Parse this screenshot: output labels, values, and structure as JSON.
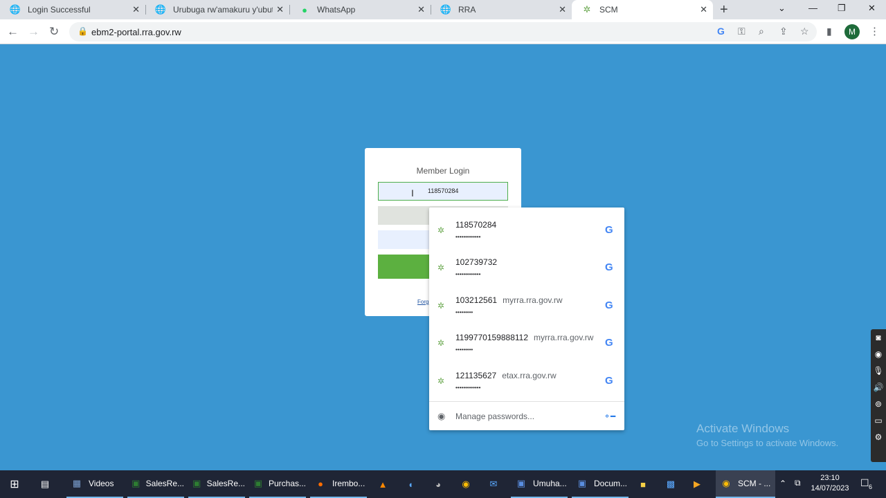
{
  "tabs": [
    {
      "label": "Login Successful",
      "icon": "globe-icon"
    },
    {
      "label": "Urubuga rw'amakuru y'ubutaka",
      "icon": "globe-icon"
    },
    {
      "label": "WhatsApp",
      "icon": "whatsapp-icon"
    },
    {
      "label": "RRA",
      "icon": "globe-icon"
    },
    {
      "label": "SCM",
      "icon": "scm-favicon-icon"
    }
  ],
  "address_bar": {
    "url": "ebm2-portal.rra.gov.rw"
  },
  "profile": {
    "initial": "M"
  },
  "login": {
    "title": "Member Login",
    "username_value": "118570284",
    "forgot_text": "Forg"
  },
  "autofill": {
    "credentials": [
      {
        "username": "118570284",
        "site": "",
        "password_mask": "•••••••••••••"
      },
      {
        "username": "102739732",
        "site": "",
        "password_mask": "•••••••••••••"
      },
      {
        "username": "103212561",
        "site": "myrra.rra.gov.rw",
        "password_mask": "•••••••••"
      },
      {
        "username": "1199770159888112",
        "site": "myrra.rra.gov.rw",
        "password_mask": "•••••••••"
      },
      {
        "username": "121135627",
        "site": "etax.rra.gov.rw",
        "password_mask": "•••••••••••••"
      }
    ],
    "manage_label": "Manage passwords..."
  },
  "watermark": {
    "title": "Activate Windows",
    "subtitle": "Go to Settings to activate Windows."
  },
  "taskbar": {
    "items": [
      {
        "label": "Videos"
      },
      {
        "label": "SalesRe..."
      },
      {
        "label": "SalesRe..."
      },
      {
        "label": "Purchas..."
      },
      {
        "label": "Irembo..."
      },
      {
        "label": "Umuha..."
      },
      {
        "label": "Docum..."
      },
      {
        "label": "SCM - ..."
      }
    ],
    "time": "23:10",
    "date": "14/07/2023",
    "notification_count": "6"
  },
  "colors": {
    "page_bg": "#3a96d1",
    "login_button": "#5cb040",
    "taskbar": "#1f2535"
  }
}
